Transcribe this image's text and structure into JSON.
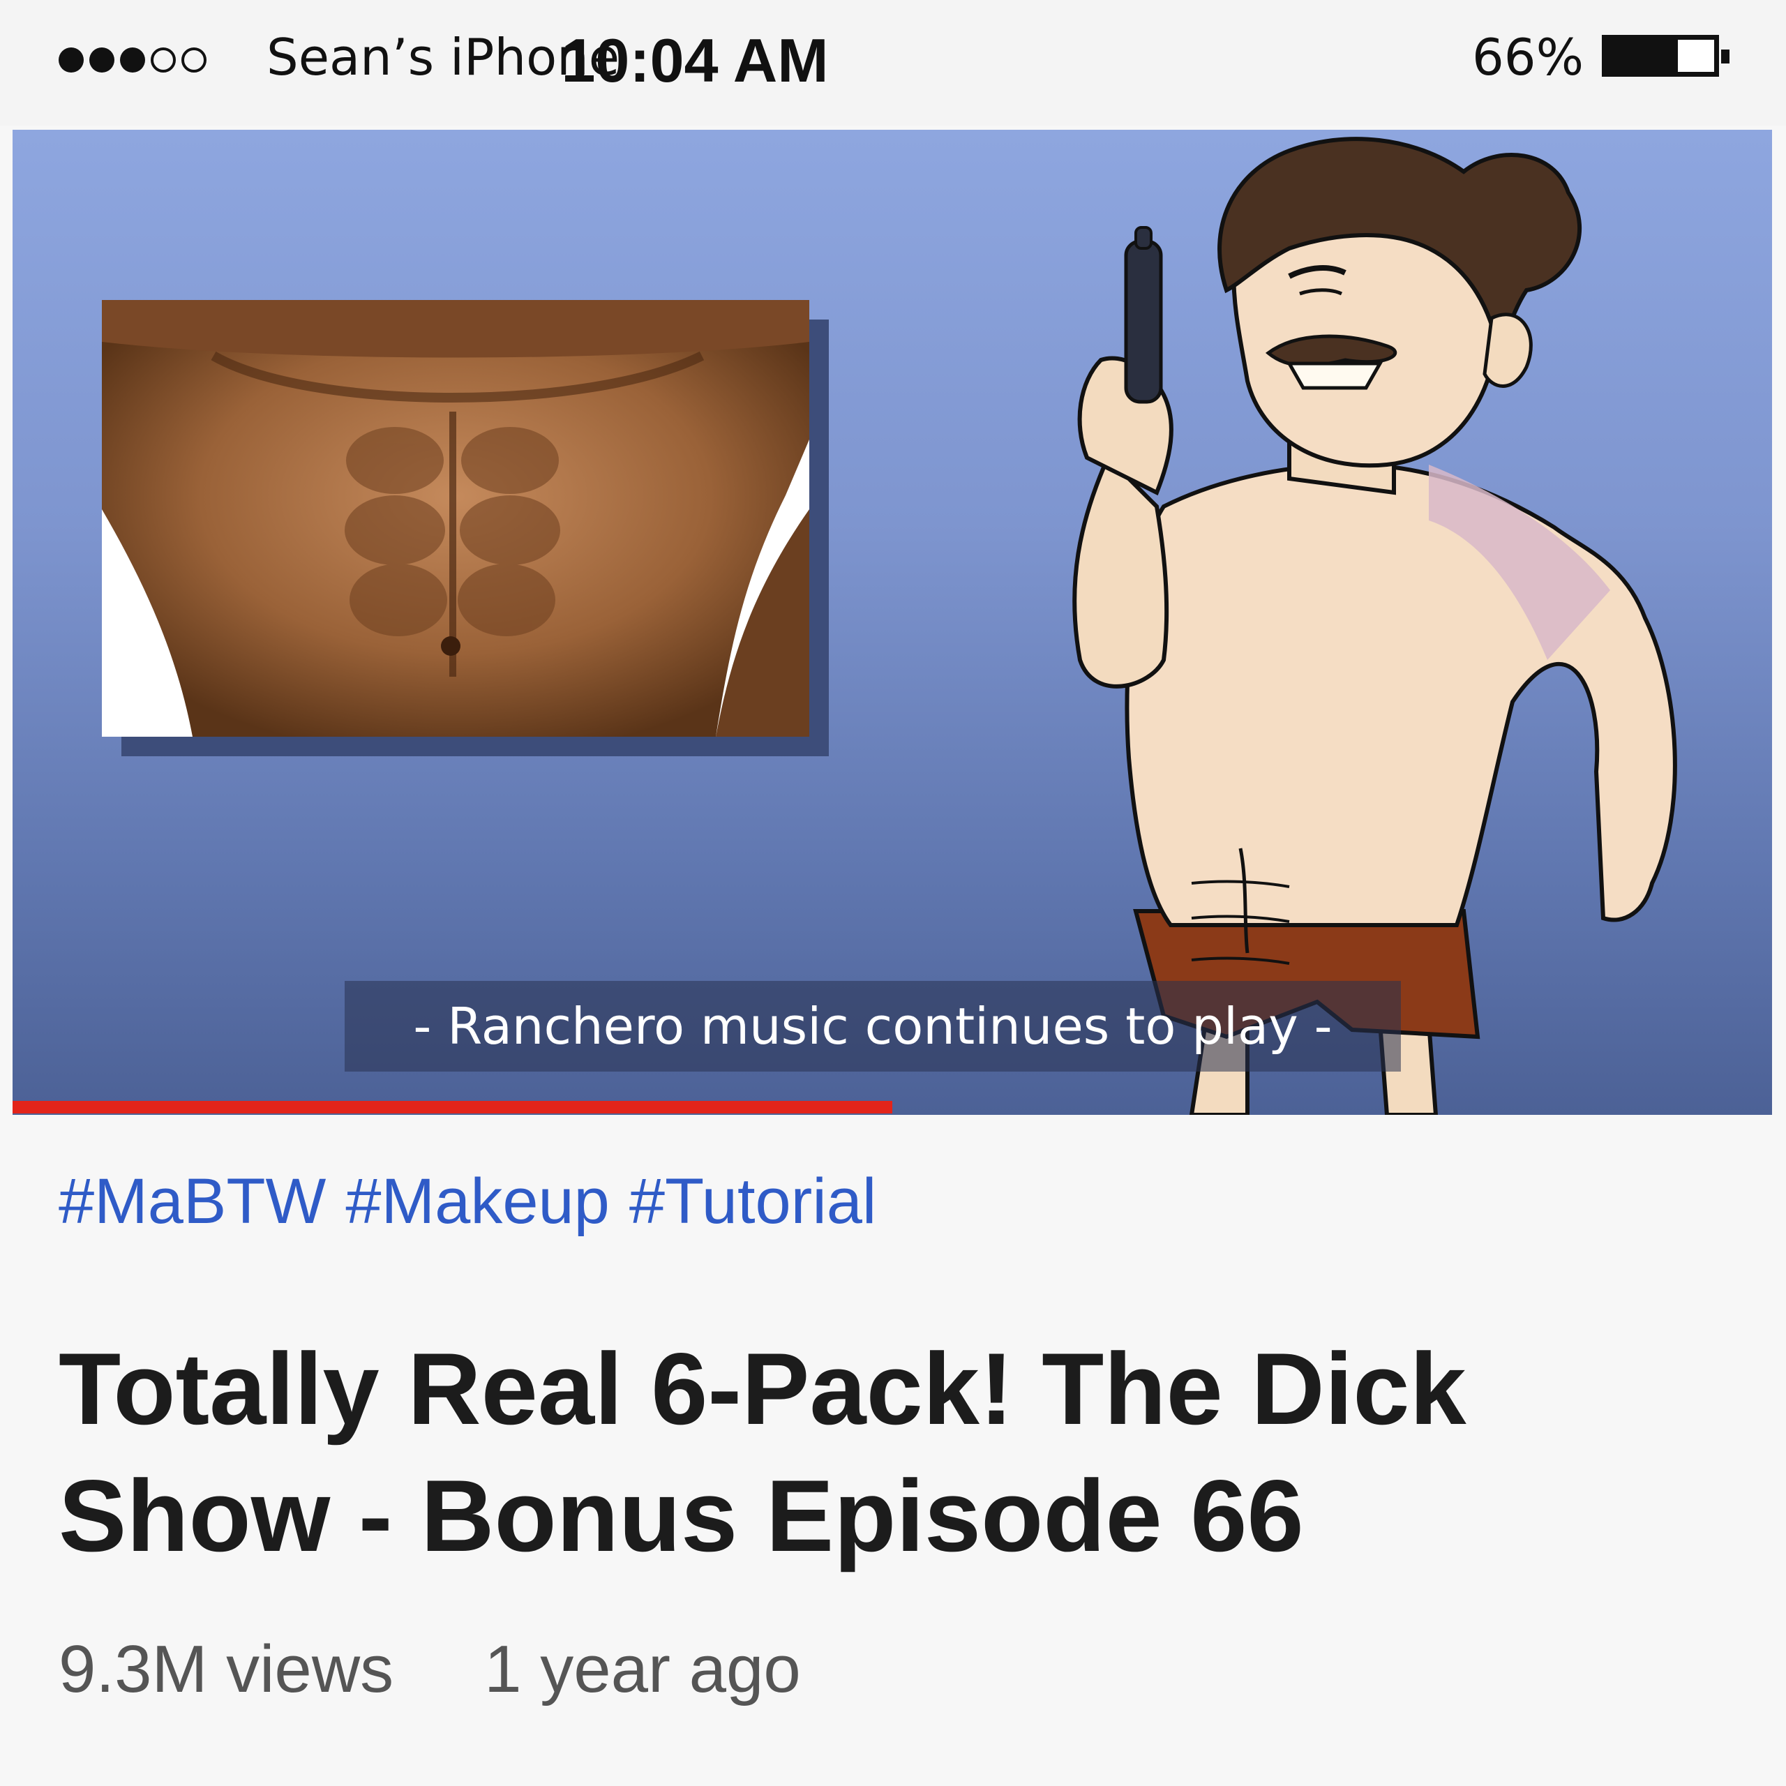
{
  "status_bar": {
    "signal_full": 3,
    "signal_total": 5,
    "carrier": "Sean’s iPhone",
    "time": "10:04 AM",
    "battery_percent_label": "66%",
    "battery_level": 0.66
  },
  "video": {
    "caption": "- Ranchero music continues to play -",
    "progress": 0.5,
    "accent_color": "#e3241a"
  },
  "hashtags": [
    "#MaBTW",
    "#Makeup",
    "#Tutorial"
  ],
  "title": "Totally Real 6-Pack! The Dick Show - Bonus Episode 66",
  "views": "9.3M views",
  "age": "1 year ago"
}
